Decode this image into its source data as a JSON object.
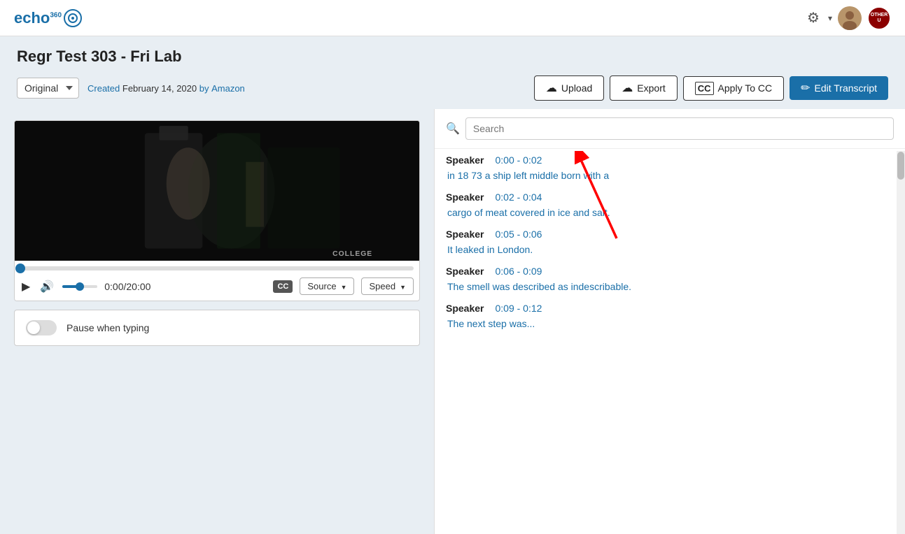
{
  "app": {
    "logo": "echo",
    "logo_sup": "360"
  },
  "header": {
    "title": "Regr Test 303 - Fri Lab",
    "version_label": "Original",
    "created_text": "Created",
    "created_date": "February 14, 2020",
    "created_by": "by",
    "created_author": "Amazon"
  },
  "toolbar": {
    "upload_label": "Upload",
    "export_label": "Export",
    "apply_cc_label": "Apply To CC",
    "edit_transcript_label": "Edit Transcript"
  },
  "player": {
    "college_watermark": "COLLEGE",
    "time_display": "0:00/20:00",
    "source_label": "Source",
    "speed_label": "Speed"
  },
  "pause_typing": {
    "label": "Pause when typing"
  },
  "search": {
    "placeholder": "Search"
  },
  "transcript": [
    {
      "speaker": "Speaker",
      "time_range": "0:00 - 0:02",
      "text": "in 18 73 a ship left middle born with a"
    },
    {
      "speaker": "Speaker",
      "time_range": "0:02 - 0:04",
      "text": "cargo of meat covered in ice and salt."
    },
    {
      "speaker": "Speaker",
      "time_range": "0:05 - 0:06",
      "text": "It leaked in London."
    },
    {
      "speaker": "Speaker",
      "time_range": "0:06 - 0:09",
      "text": "The smell was described as indescribable."
    },
    {
      "speaker": "Speaker",
      "time_range": "0:09 - 0:12",
      "text": "The next step was..."
    }
  ],
  "colors": {
    "primary": "#1a6fa8",
    "border": "#ccc",
    "text_dark": "#222",
    "text_muted": "#555"
  }
}
